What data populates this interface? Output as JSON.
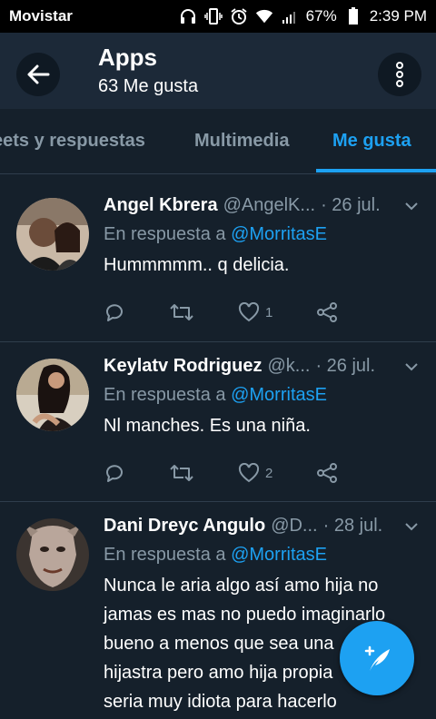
{
  "status_bar": {
    "carrier": "Movistar",
    "battery": "67%",
    "time": "2:39 PM"
  },
  "header": {
    "title": "Apps",
    "subtitle": "63 Me gusta"
  },
  "tabs": [
    {
      "label": "eets y respuestas",
      "active": false
    },
    {
      "label": "Multimedia",
      "active": false
    },
    {
      "label": "Me gusta",
      "active": true
    }
  ],
  "tweets": [
    {
      "name": "Angel Kbrera",
      "handle": "@AngelK...",
      "date": "· 26 jul.",
      "reply_prefix": "En respuesta a",
      "reply_to": "@MorritasE",
      "text": "Hummmmm.. q delicia.",
      "likes": "1"
    },
    {
      "name": "Keylatv Rodriguez",
      "handle": "@k...",
      "date": "· 26 jul.",
      "reply_prefix": "En respuesta a",
      "reply_to": "@MorritasE",
      "text": "Nl manches. Es una niña.",
      "likes": "2"
    },
    {
      "name": "Dani Dreyc Angulo",
      "handle": "@D...",
      "date": "· 28 jul.",
      "reply_prefix": "En respuesta a",
      "reply_to": "@MorritasE",
      "text_lines": [
        "Nunca le aria algo así amo hija no",
        "jamas es mas no puedo imaginarlo",
        "bueno a menos que sea una",
        "hijastra pero amo hija propia",
        "seria muy idiota para hacerlo"
      ]
    }
  ],
  "colors": {
    "background": "#15202b",
    "appbar": "#1c2938",
    "accent": "#1da1f2",
    "muted": "#8899a6"
  },
  "icons": [
    "headphones-icon",
    "vibrate-icon",
    "alarm-icon",
    "wifi-icon",
    "signal-icon",
    "battery-icon",
    "back-arrow-icon",
    "more-vertical-icon",
    "chevron-down-icon",
    "reply-icon",
    "retweet-icon",
    "heart-icon",
    "share-icon",
    "compose-icon"
  ]
}
